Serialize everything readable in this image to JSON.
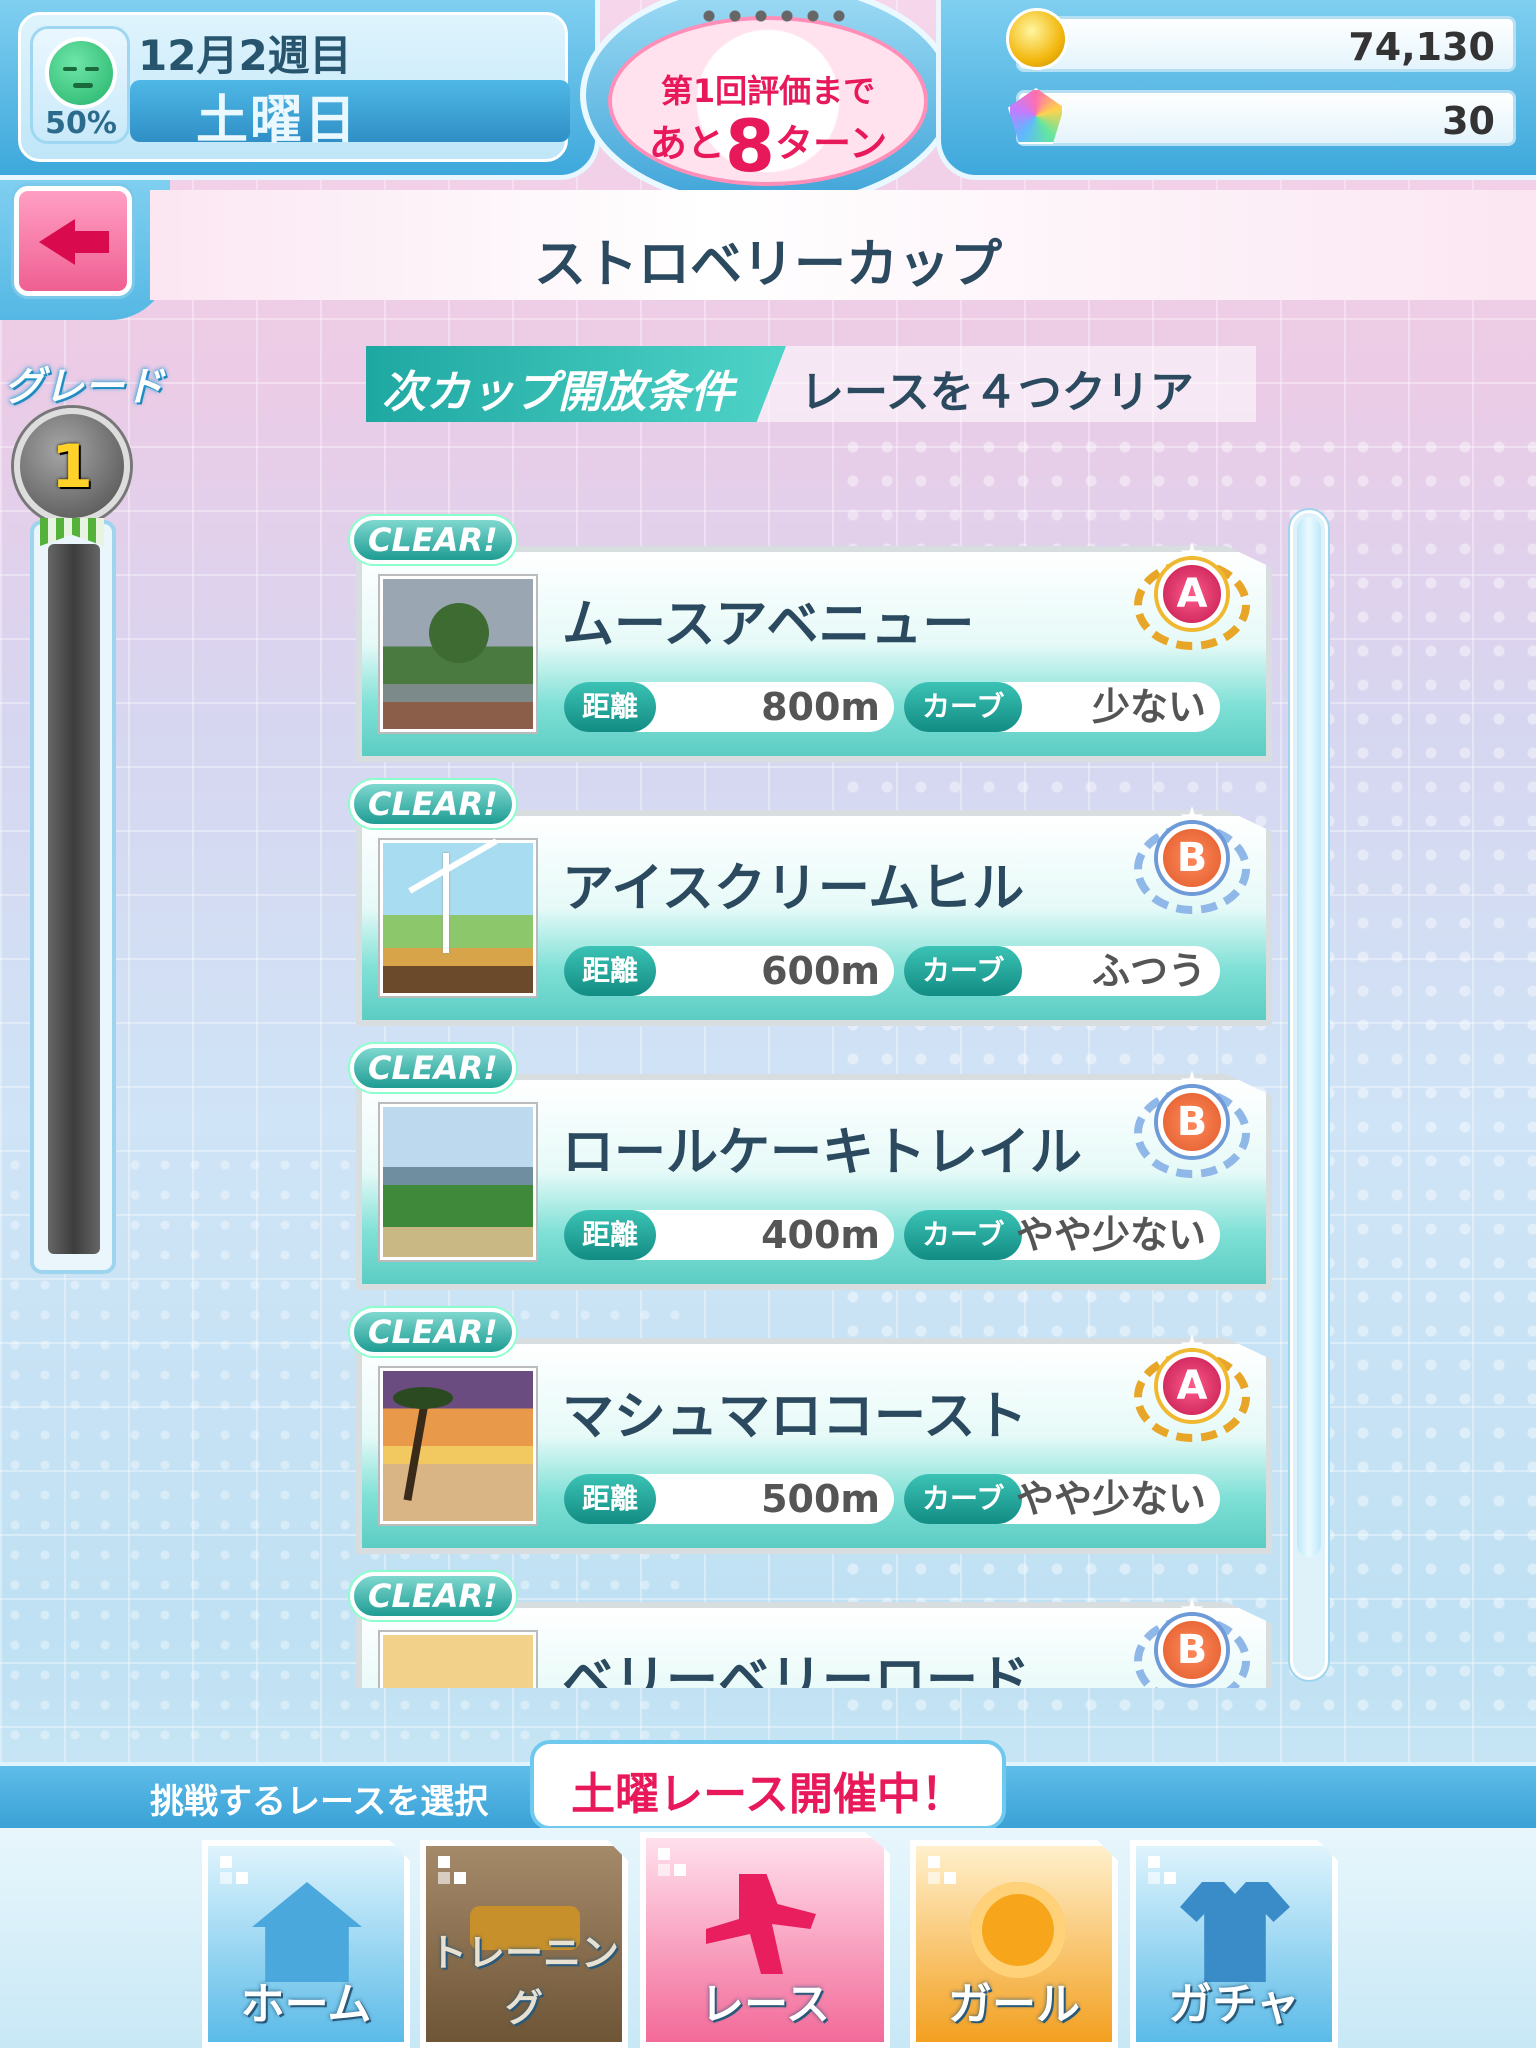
{
  "header": {
    "mood_percent": "50%",
    "date": "12月2週目",
    "day": "土曜日",
    "turn_line1": "第1回評価まで",
    "turn_prefix": "あと",
    "turn_number": "8",
    "turn_suffix": "ターン",
    "coins": "74,130",
    "gems": "30"
  },
  "page": {
    "title": "ストロベリーカップ",
    "condition_label": "次カップ開放条件",
    "condition_value": "レースを４つクリア",
    "grade_label": "グレード",
    "grade_value": "1"
  },
  "races": [
    {
      "badge": "CLEAR!",
      "name": "ムースアベニュー",
      "dist_label": "距離",
      "distance": "800m",
      "curve_label": "カーブ",
      "curve": "少ない",
      "rank": "A"
    },
    {
      "badge": "CLEAR!",
      "name": "アイスクリームヒル",
      "dist_label": "距離",
      "distance": "600m",
      "curve_label": "カーブ",
      "curve": "ふつう",
      "rank": "B"
    },
    {
      "badge": "CLEAR!",
      "name": "ロールケーキトレイル",
      "dist_label": "距離",
      "distance": "400m",
      "curve_label": "カーブ",
      "curve": "やや少ない",
      "rank": "B"
    },
    {
      "badge": "CLEAR!",
      "name": "マシュマロコースト",
      "dist_label": "距離",
      "distance": "500m",
      "curve_label": "カーブ",
      "curve": "やや少ない",
      "rank": "A"
    },
    {
      "badge": "CLEAR!",
      "name": "ベリーベリーロード",
      "rank": "B"
    }
  ],
  "footer": {
    "hint": "挑戦するレースを選択",
    "bubble": "土曜レース開催中！"
  },
  "nav": {
    "home": "ホーム",
    "training": "トレーニング",
    "race": "レース",
    "girl": "ガール",
    "gacha": "ガチャ"
  }
}
